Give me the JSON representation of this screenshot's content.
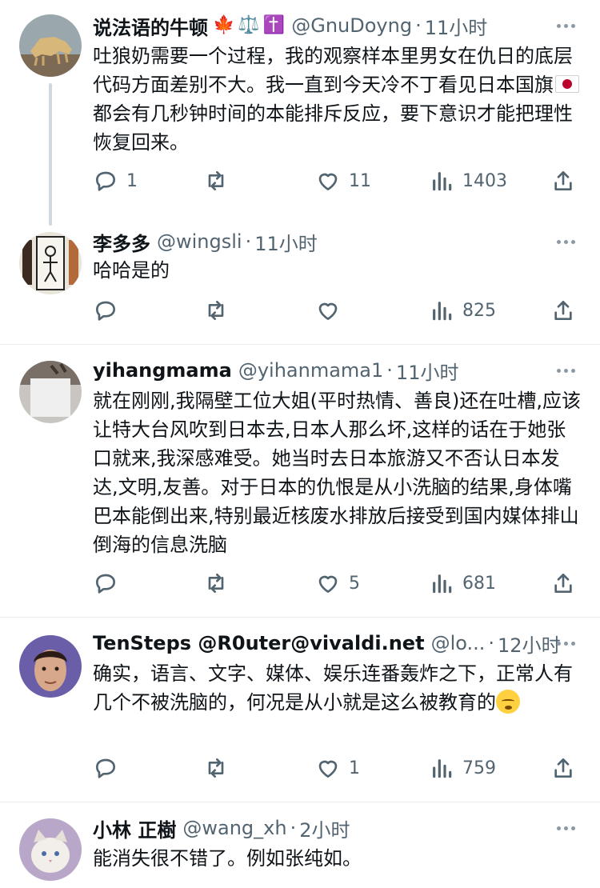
{
  "tweets": [
    {
      "name": "说法语的牛顿",
      "badges": [
        "🍁",
        "⚖️",
        "✝️"
      ],
      "handle": "@GnuDoyng",
      "dot": "·",
      "time": "11小时",
      "text_a": "吐狼奶需要一个过程，我的观察样本里男女在仇日的底层代码方面差别不大。我一直到今天冷不丁看见日本国旗",
      "flag_icon": "japan-flag-icon",
      "text_b": "都会有几秒钟时间的本能排斥反应，要下意识才能把理性恢复回来。",
      "replies": "1",
      "retweets": "",
      "likes": "11",
      "views": "1403"
    },
    {
      "name": "李多多",
      "handle": "@wingsli",
      "dot": "·",
      "time": "11小时",
      "text": "哈哈是的",
      "replies": "",
      "retweets": "",
      "likes": "",
      "views": "825"
    },
    {
      "name": "yihangmama",
      "handle": "@yihanmama1",
      "dot": "·",
      "time": "11小时",
      "text": "就在刚刚,我隔壁工位大姐(平时热情、善良)还在吐槽,应该让特大台风吹到日本去,日本人那么坏,这样的话在于她张口就来,我深感难受。她当时去日本旅游又不否认日本发达,文明,友善。对于日本的仇恨是从小洗脑的结果,身体嘴巴本能倒出来,特别最近核废水排放后接受到国内媒体排山倒海的信息洗脑",
      "replies": "",
      "retweets": "",
      "likes": "5",
      "views": "681"
    },
    {
      "name": "TenSteps @R0uter@vivaldi.net",
      "handle": "@lo...",
      "dot": "·",
      "time": "12小时",
      "text": "确实，语言、文字、媒体、娱乐连番轰炸之下，正常人有几个不被洗脑的，何况是从小就是这么被教育的",
      "emoji_icon": "exhaling-face-emoji",
      "replies": "",
      "retweets": "",
      "likes": "1",
      "views": "759"
    },
    {
      "name": "小林 正樹",
      "handle": "@wang_xh",
      "dot": "·",
      "time": "2小时",
      "text": "能消失很不错了。例如张纯如。"
    }
  ],
  "icons": {
    "reply": "reply-icon",
    "retweet": "retweet-icon",
    "like": "heart-icon",
    "views": "views-icon",
    "share": "share-icon",
    "more": "more-icon"
  },
  "colors": {
    "text": "#0f1419",
    "muted": "#536471",
    "divider": "#e6ecf0",
    "thread_line": "#cfd9de"
  }
}
